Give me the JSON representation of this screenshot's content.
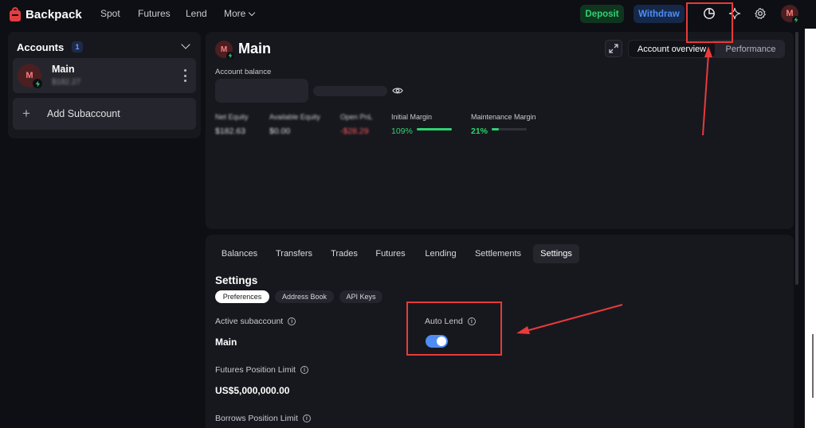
{
  "brand": {
    "name": "Backpack"
  },
  "nav": {
    "spot": "Spot",
    "futures": "Futures",
    "lend": "Lend",
    "more": "More"
  },
  "topbar": {
    "deposit": "Deposit",
    "withdraw": "Withdraw",
    "avatar_initial": "M"
  },
  "accounts": {
    "title": "Accounts",
    "count": "1",
    "items": [
      {
        "initial": "M",
        "name": "Main",
        "value": "$182.27"
      }
    ],
    "add_label": "Add Subaccount"
  },
  "overview": {
    "initial": "M",
    "title": "Main",
    "segments": {
      "active": "Account overview",
      "other": "Performance"
    },
    "balance_label": "Account balance",
    "metrics": {
      "net_equity": {
        "label": "Net Equity",
        "value": "$182.63"
      },
      "available_equity": {
        "label": "Available Equity",
        "value": "$0.00"
      },
      "open_pnl": {
        "label": "Open PnL",
        "value": "-$28.29"
      },
      "initial_margin": {
        "label": "Initial Margin",
        "value": "109%",
        "fill": 1.0
      },
      "maintenance_margin": {
        "label": "Maintenance Margin",
        "value": "21%",
        "fill": 0.21
      }
    }
  },
  "settings": {
    "tabs": [
      "Balances",
      "Transfers",
      "Trades",
      "Futures",
      "Lending",
      "Settlements",
      "Settings"
    ],
    "active_tab": "Settings",
    "title": "Settings",
    "subtabs": [
      "Preferences",
      "Address Book",
      "API Keys"
    ],
    "active_subtab": "Preferences",
    "active_subaccount": {
      "label": "Active subaccount",
      "value": "Main"
    },
    "auto_lend": {
      "label": "Auto Lend",
      "enabled": true
    },
    "futures_limit": {
      "label": "Futures Position Limit",
      "value": "US$5,000,000.00"
    },
    "borrows_limit": {
      "label": "Borrows Position Limit"
    }
  },
  "colors": {
    "background": "#0e0f14",
    "panel": "#17181e",
    "accent_green": "#2dd36f",
    "accent_blue": "#4f8df5",
    "brand_red": "#e33e3f",
    "annotation_red": "#e83a3a"
  }
}
